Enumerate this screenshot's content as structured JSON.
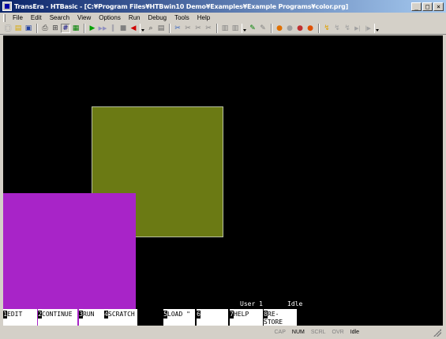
{
  "window": {
    "title": "TransEra - HTBasic - [C:¥Program Files¥HTBwin10 Demo¥Examples¥Example Programs¥color.prg]",
    "minimize": "_",
    "maximize": "□",
    "close": "×"
  },
  "menu": [
    "File",
    "Edit",
    "Search",
    "View",
    "Options",
    "Run",
    "Debug",
    "Tools",
    "Help"
  ],
  "toolbar": {
    "new": "▢",
    "open": "▤",
    "save": "▣",
    "print": "⎙",
    "tool5": "⊞",
    "tool6": "#",
    "tool7": "▦",
    "run": "▶",
    "continue": "▶▶",
    "pause": "‖",
    "stop": "■",
    "reset": "◀",
    "find": "⌕",
    "find2": "▤",
    "tool14": "✂",
    "tool15": "✂",
    "tool16": "✂",
    "tool17": "✂",
    "tool18": "▥",
    "tool19": "▥",
    "tool20": "✎",
    "tool21": "✎",
    "tool22": "●",
    "tool23": "●",
    "tool24": "●",
    "tool25": "●",
    "tool26": "↯",
    "tool27": "↯",
    "tool28": "↯",
    "tool29": "▶|",
    "tool30": "|▶"
  },
  "output": {
    "user_label": "User 1",
    "status_label": "Idle"
  },
  "softkeys": [
    {
      "num": "1",
      "label": "EDIT"
    },
    {
      "num": "2",
      "label": "CONTINUE"
    },
    {
      "num": "3",
      "label": "RUN"
    },
    {
      "num": "4",
      "label": "SCRATCH"
    },
    {
      "num": "5",
      "label": "LOAD \""
    },
    {
      "num": "6",
      "label": ""
    },
    {
      "num": "7",
      "label": "HELP"
    },
    {
      "num": "8",
      "label": "RE-STORE"
    }
  ],
  "statusbar": {
    "cap": "CAP",
    "num": "NUM",
    "scrl": "SCRL",
    "ovr": "OVR",
    "state": "Idle"
  },
  "colors": {
    "olive_rect": "#6b7a14",
    "purple_rect": "#a824c8",
    "screen_bg": "#000000"
  }
}
